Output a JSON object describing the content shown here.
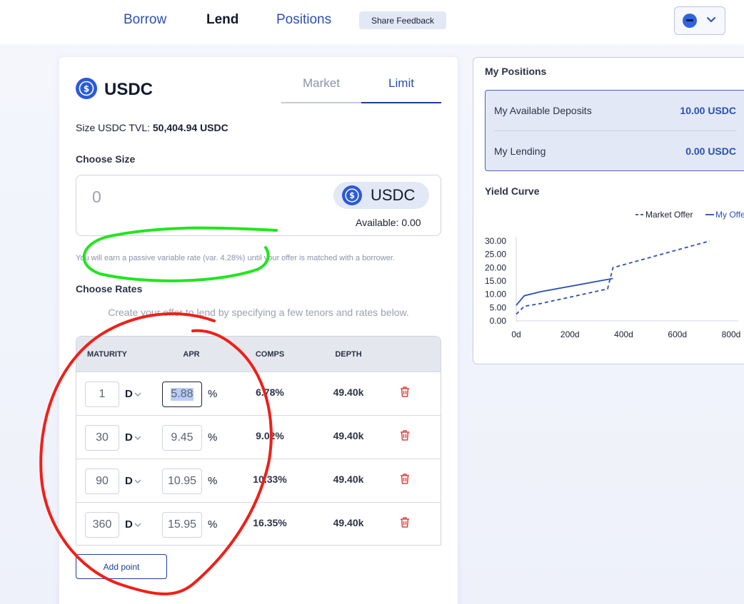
{
  "nav": {
    "borrow": "Borrow",
    "lend": "Lend",
    "positions": "Positions",
    "feedback": "Share Feedback"
  },
  "lend": {
    "asset": "USDC",
    "tabs": {
      "market": "Market",
      "limit": "Limit"
    },
    "tvl_label": "Size USDC TVL:",
    "tvl_value": "50,404.94 USDC",
    "choose_size": "Choose Size",
    "size_value": "0",
    "size_token": "USDC",
    "available": "Available: 0.00",
    "passive_note": "You will earn a passive variable rate (var. 4.28%) until your offer is matched with a borrower.",
    "choose_rates": "Choose Rates",
    "hint": "Create your offer to lend by specifying a few tenors and rates below.",
    "columns": [
      "MATURITY",
      "APR",
      "COMPS",
      "DEPTH"
    ],
    "rows": [
      {
        "days": "1",
        "unit": "D",
        "apr": "5.88",
        "pct": "%",
        "comps": "6.78%",
        "depth": "49.40k"
      },
      {
        "days": "30",
        "unit": "D",
        "apr": "9.45",
        "pct": "%",
        "comps": "9.02%",
        "depth": "49.40k"
      },
      {
        "days": "90",
        "unit": "D",
        "apr": "10.95",
        "pct": "%",
        "comps": "10.33%",
        "depth": "49.40k"
      },
      {
        "days": "360",
        "unit": "D",
        "apr": "15.95",
        "pct": "%",
        "comps": "16.35%",
        "depth": "49.40k"
      }
    ],
    "add_point": "Add point"
  },
  "my_positions": {
    "title": "My Positions",
    "deposits_label": "My Available Deposits",
    "deposits_value": "10.00 USDC",
    "lending_label": "My Lending",
    "lending_value": "0.00 USDC",
    "yield_title": "Yield Curve"
  },
  "chart_data": {
    "type": "line",
    "title": "Yield Curve",
    "xlabel": "",
    "ylabel": "",
    "xlim": [
      0,
      800
    ],
    "ylim": [
      0,
      30
    ],
    "x_ticks": [
      "0d",
      "200d",
      "400d",
      "600d",
      "800d"
    ],
    "y_ticks": [
      "30.00",
      "25.00",
      "20.00",
      "15.00",
      "10.00",
      "5.00",
      "0.00"
    ],
    "legend_position": "top-right",
    "series": [
      {
        "name": "Market Offer",
        "style": "dashed",
        "color": "#2a4fb5",
        "x": [
          0,
          30,
          90,
          340,
          360,
          720
        ],
        "y": [
          2.5,
          5.5,
          6.5,
          12,
          20,
          30
        ]
      },
      {
        "name": "My Offer",
        "style": "solid",
        "color": "#2a4fb5",
        "x": [
          0,
          30,
          90,
          360
        ],
        "y": [
          5.88,
          9.45,
          10.95,
          15.95
        ]
      }
    ]
  },
  "colors": {
    "accent": "#2a4fb5",
    "danger": "#e0443f",
    "annotation_green": "#22e51e",
    "annotation_red": "#ee2018"
  }
}
